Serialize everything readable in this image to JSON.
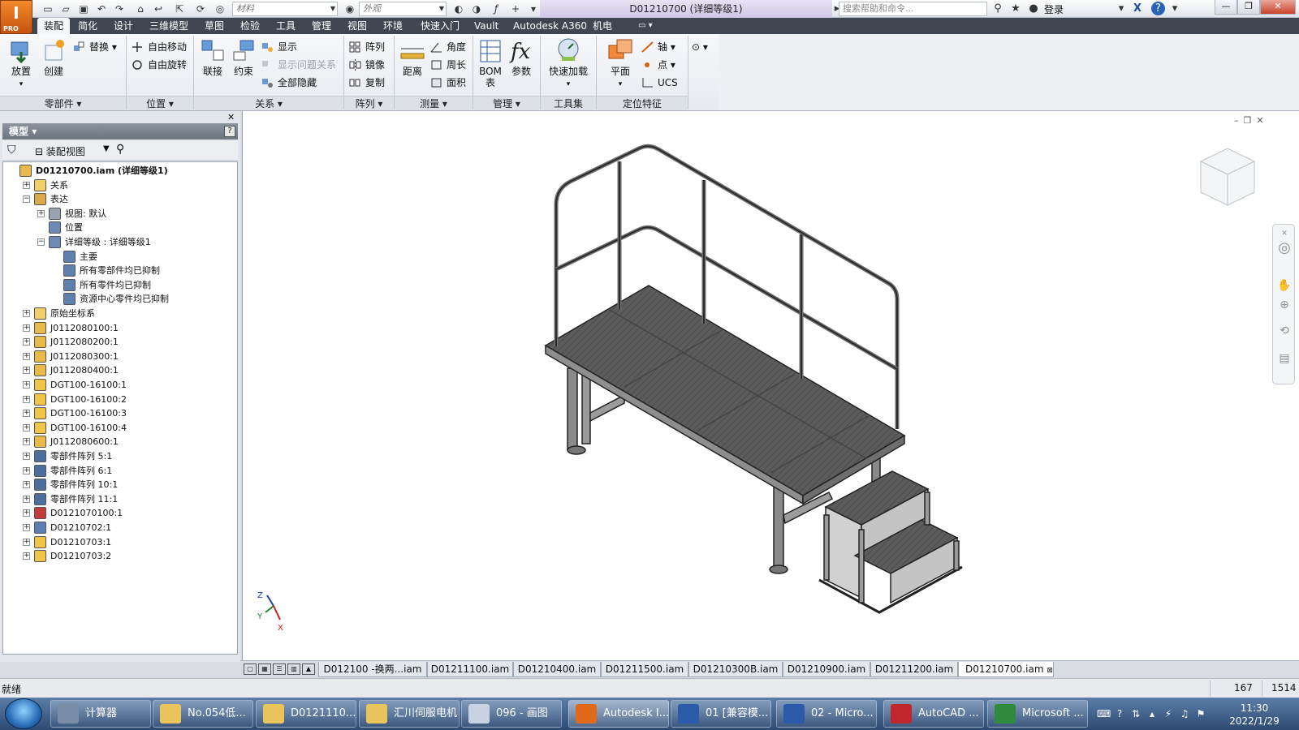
{
  "titlebar": {
    "app_button_letter": "I",
    "app_button_sub": "PRO",
    "material_placeholder": "材料",
    "appearance_placeholder": "外观",
    "document_title": "D01210700 (详细等级1)",
    "search_placeholder": "搜索帮助和命令...",
    "login_label": "登录"
  },
  "tabs": [
    "装配",
    "简化",
    "设计",
    "三维模型",
    "草图",
    "检验",
    "工具",
    "管理",
    "视图",
    "环境",
    "快速入门",
    "Vault",
    "Autodesk A360",
    "机电"
  ],
  "active_tab": "装配",
  "ribbon": {
    "panels": [
      {
        "title": "零部件",
        "buttons": {
          "place": "放置",
          "create": "创建",
          "replace": "替换"
        }
      },
      {
        "title": "位置",
        "buttons": {
          "free_move": "自由移动",
          "free_rotate": "自由旋转"
        }
      },
      {
        "title": "关系",
        "buttons": {
          "joint": "联接",
          "constrain": "约束",
          "show": "显示",
          "show_problem": "显示问题关系",
          "hide_all": "全部隐藏"
        }
      },
      {
        "title": "阵列",
        "buttons": {
          "pattern": "阵列",
          "mirror": "镜像",
          "copy": "复制"
        }
      },
      {
        "title": "测量",
        "buttons": {
          "distance": "距离",
          "angle": "角度",
          "loop": "周长",
          "area": "面积"
        }
      },
      {
        "title": "管理",
        "buttons": {
          "bom_line1": "BOM",
          "bom_line2": "表",
          "params": "参数"
        }
      },
      {
        "title": "工具集",
        "buttons": {
          "quick_load": "快速加载"
        }
      },
      {
        "title": "定位特征",
        "buttons": {
          "plane": "平面",
          "axis": "轴",
          "point": "点",
          "ucs": "UCS"
        }
      }
    ]
  },
  "browser": {
    "header": "模型",
    "help": "?",
    "view_label": "装配视图",
    "tree": [
      {
        "label": "D01210700.iam (详细等级1)",
        "bold": true
      },
      {
        "label": "关系"
      },
      {
        "label": "表达"
      },
      {
        "label": "视图: 默认"
      },
      {
        "label": "位置"
      },
      {
        "label": "详细等级 : 详细等级1"
      },
      {
        "label": "主要"
      },
      {
        "label": "所有零部件均已抑制"
      },
      {
        "label": "所有零件均已抑制"
      },
      {
        "label": "资源中心零件均已抑制"
      },
      {
        "label": "原始坐标系"
      },
      {
        "label": "J0112080100:1"
      },
      {
        "label": "J0112080200:1"
      },
      {
        "label": "J0112080300:1"
      },
      {
        "label": "J0112080400:1"
      },
      {
        "label": "DGT100-16100:1"
      },
      {
        "label": "DGT100-16100:2"
      },
      {
        "label": "DGT100-16100:3"
      },
      {
        "label": "DGT100-16100:4"
      },
      {
        "label": "J0112080600:1"
      },
      {
        "label": "零部件阵列 5:1"
      },
      {
        "label": "零部件阵列 6:1"
      },
      {
        "label": "零部件阵列 10:1"
      },
      {
        "label": "零部件阵列 11:1"
      },
      {
        "label": "D0121070100:1"
      },
      {
        "label": "D01210702:1"
      },
      {
        "label": "D01210703:1"
      },
      {
        "label": "D01210703:2"
      }
    ]
  },
  "viewport": {
    "axis_labels": {
      "z": "Z",
      "y": "Y",
      "x": "X"
    }
  },
  "doc_tabs": [
    "D012100 -换两...iam",
    "D01211100.iam",
    "D01210400.iam",
    "D01211500.iam",
    "D01210300B.iam",
    "D01210900.iam",
    "D01211200.iam",
    "D01210700.iam"
  ],
  "active_doc_tab": "D01210700.iam",
  "statusbar": {
    "text": "就绪",
    "num1": "167",
    "num2": "1514"
  },
  "taskbar": {
    "items": [
      {
        "label": "计算器",
        "color": "#7a8da6"
      },
      {
        "label": "No.054低...",
        "color": "#e8c45a"
      },
      {
        "label": "D0121110...",
        "color": "#e8c45a"
      },
      {
        "label": "汇川伺服电机",
        "color": "#e8c45a"
      },
      {
        "label": "096 - 画图",
        "color": "#c8d2e0"
      },
      {
        "label": "Autodesk I...",
        "color": "#e06a1a"
      },
      {
        "label": "01 [兼容模...",
        "color": "#2b5aa8"
      },
      {
        "label": "02 - Micro...",
        "color": "#2b5aa8"
      },
      {
        "label": "AutoCAD ...",
        "color": "#c0262b"
      },
      {
        "label": "Microsoft ...",
        "color": "#2f8a3c"
      }
    ],
    "time": "11:30",
    "date": "2022/1/29"
  }
}
